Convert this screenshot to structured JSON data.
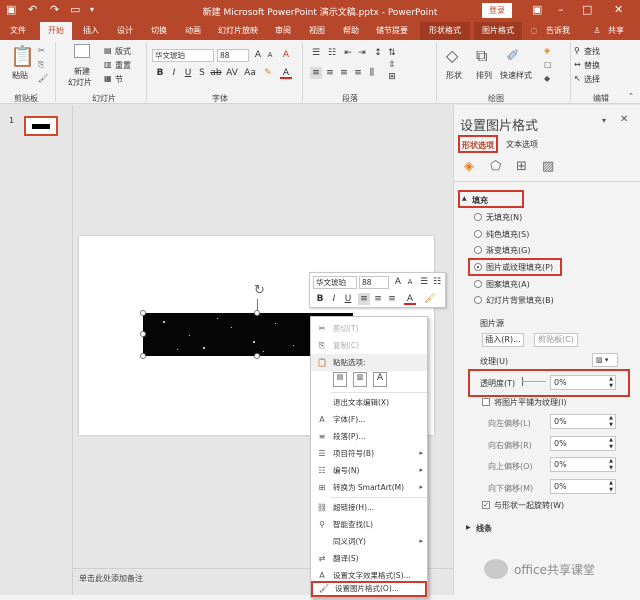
{
  "title": "新建 Microsoft PowerPoint 演示文稿.pptx - PowerPoint",
  "login_button": "登录",
  "tabs": [
    "文件",
    "开始",
    "插入",
    "设计",
    "切换",
    "动画",
    "幻灯片放映",
    "审阅",
    "视图",
    "帮助",
    "储节提要",
    "形状格式",
    "图片格式",
    "告诉我",
    "共享"
  ],
  "ribbon": {
    "clipboard": {
      "paste": "粘贴",
      "group": "剪贴板"
    },
    "slides": {
      "new_slide": "新建",
      "new_slide2": "幻灯片",
      "layout": "版式",
      "reset": "重置",
      "section": "节",
      "group": "幻灯片"
    },
    "font": {
      "name": "华文琥珀",
      "size": "88",
      "group": "字体"
    },
    "paragraph": {
      "group": "段落"
    },
    "drawing": {
      "shapes": "形状",
      "arrange": "排列",
      "quick_styles": "快速样式",
      "group": "绘图"
    },
    "editing": {
      "find": "查找",
      "replace": "替换",
      "select": "选择",
      "group": "编辑"
    }
  },
  "slide_number": "1",
  "notes_placeholder": "单击此处添加备注",
  "mini_toolbar": {
    "font": "华文琥珀",
    "size": "88"
  },
  "context_menu": [
    {
      "label": "剪切(T)",
      "disabled": true
    },
    {
      "label": "复制(C)",
      "disabled": true
    },
    {
      "label": "粘贴选项:",
      "disabled": false
    },
    {
      "label": "退出文本编辑(X)",
      "disabled": false
    },
    {
      "label": "字体(F)...",
      "disabled": false
    },
    {
      "label": "段落(P)...",
      "disabled": false
    },
    {
      "label": "项目符号(B)",
      "disabled": false,
      "submenu": true
    },
    {
      "label": "编号(N)",
      "disabled": false,
      "submenu": true
    },
    {
      "label": "转换为 SmartArt(M)",
      "disabled": false,
      "submenu": true
    },
    {
      "label": "超链接(H)...",
      "disabled": false
    },
    {
      "label": "智能查找(L)",
      "disabled": false
    },
    {
      "label": "同义词(Y)",
      "disabled": false,
      "submenu": true
    },
    {
      "label": "翻译(S)",
      "disabled": false
    },
    {
      "label": "设置文字效果格式(S)...",
      "disabled": false
    },
    {
      "label": "设置图片格式(O)...",
      "disabled": false
    }
  ],
  "format_pane": {
    "title": "设置图片格式",
    "tab_shape": "形状选项",
    "tab_text": "文本选项",
    "fill_header": "填充",
    "fill_options": [
      "无填充(N)",
      "纯色填充(S)",
      "渐变填充(G)",
      "图片或纹理填充(P)",
      "图案填充(A)",
      "幻灯片背景填充(B)"
    ],
    "selected_fill": 3,
    "picture_source": "图片源",
    "insert_btn": "插入(R)...",
    "clipboard_btn": "剪贴板(C)",
    "texture": "纹理(U)",
    "transparency_label": "透明度(T)",
    "transparency_value": "0%",
    "tile_label": "将图片平铺为纹理(I)",
    "offsets": [
      {
        "label": "向左偏移(L)",
        "value": "0%"
      },
      {
        "label": "向右偏移(R)",
        "value": "0%"
      },
      {
        "label": "向上偏移(O)",
        "value": "0%"
      },
      {
        "label": "向下偏移(M)",
        "value": "0%"
      }
    ],
    "rotate_label": "与形状一起旋转(W)",
    "line_header": "线条"
  },
  "watermark": "office共享课堂",
  "colors": {
    "brand": "#b7472a",
    "highlight": "#d0392b"
  }
}
